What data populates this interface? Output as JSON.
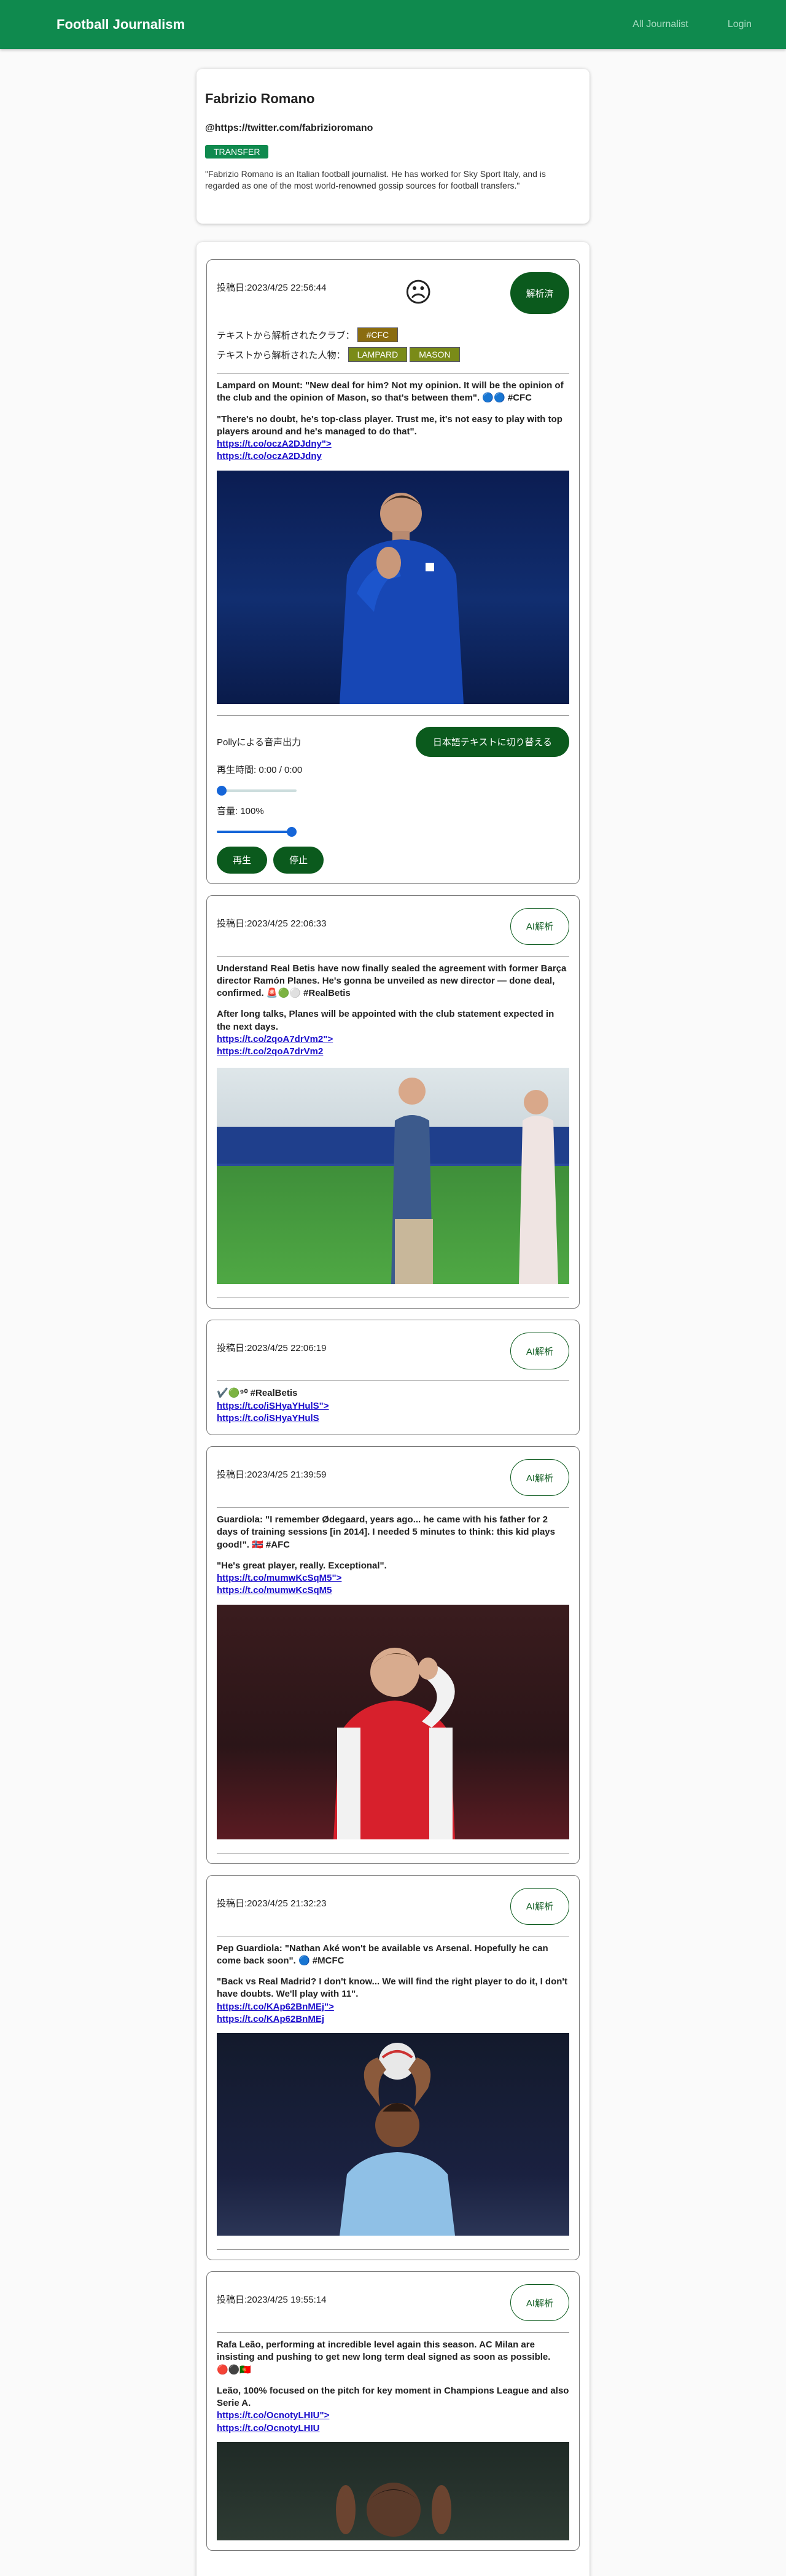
{
  "header": {
    "brand": "Football Journalism",
    "nav": [
      "All Journalist",
      "Login"
    ]
  },
  "profile": {
    "name": "Fabrizio Romano",
    "twitter": "@https://twitter.com/fabrizioromano",
    "tag": "TRANSFER",
    "bio": "\"Fabrizio Romano is an Italian football journalist. He has worked for Sky Sport Italy, and is regarded as one of the most world-renowned gossip sources for football transfers.\""
  },
  "labels": {
    "club": "テキストから解析されたクラブ：",
    "person": "テキストから解析された人物：",
    "done": "解析済",
    "ai": "AI解析",
    "polly": "Pollyによる音声出力",
    "switch_jp": "日本語テキストに切り替える",
    "time": "再生時間: 0:00 / 0:00",
    "volume": "音量: 100%",
    "play": "再生",
    "stop": "停止"
  },
  "audio": {
    "progress": 0,
    "volume": 1.0
  },
  "posts": [
    {
      "date": "投稿日:2023/4/25 22:56:44",
      "sentiment_icon": "sad-face-icon",
      "sentiment": "☹",
      "clubs": [
        "#CFC"
      ],
      "people": [
        "LAMPARD",
        "MASON"
      ],
      "p1": "Lampard on Mount: \"New deal for him? Not my opinion. It will be the opinion of the club and the opinion of Mason, so that's between them\". 🔵🔵 #CFC",
      "p2": "\"There's no doubt, he's top-class player. Trust me, it's not easy to play with top players around and he's managed to do that\".",
      "link1": "https://t.co/oczA2DJdny\">",
      "link2": "https://t.co/oczA2DJdny"
    },
    {
      "date": "投稿日:2023/4/25 22:06:33",
      "p1": "Understand Real Betis have now finally sealed the agreement with former Barça director Ramón Planes. He's gonna be unveiled as new director — done deal, confirmed. 🚨🟢⚪️ #RealBetis",
      "p2": "After long talks, Planes will be appointed with the club statement expected in the next days.",
      "link1": "https://t.co/2qoA7drVm2\">",
      "link2": "https://t.co/2qoA7drVm2"
    },
    {
      "date": "投稿日:2023/4/25 22:06:19",
      "p1": "✔️🟢⁹⁰ #RealBetis",
      "link1": "https://t.co/iSHyaYHulS\">",
      "link2": "https://t.co/iSHyaYHulS"
    },
    {
      "date": "投稿日:2023/4/25 21:39:59",
      "p1": "Guardiola: \"I remember Ødegaard, years ago... he came with his father for 2 days of training sessions [in 2014]. I needed 5 minutes to think: this kid plays good!\". 🇳🇴 #AFC",
      "p2": "\"He's great player, really. Exceptional\".",
      "link1": "https://t.co/mumwKcSqM5\">",
      "link2": "https://t.co/mumwKcSqM5"
    },
    {
      "date": "投稿日:2023/4/25 21:32:23",
      "p1": "Pep Guardiola: \"Nathan Aké won't be available vs Arsenal. Hopefully he can come back soon\". 🔵 #MCFC",
      "p2": "\"Back vs Real Madrid? I don't know... We will find the right player to do it, I don't have doubts. We'll play with 11\".",
      "link1": "https://t.co/KAp62BnMEj\">",
      "link2": "https://t.co/KAp62BnMEj"
    },
    {
      "date": "投稿日:2023/4/25 19:55:14",
      "p1": "Rafa Leão, performing at incredible level again this season. AC Milan are insisting and pushing to get new long term deal signed as soon as possible. 🔴⚫🇵🇹",
      "p2": "Leão, 100% focused on the pitch for key moment in Champions League and also Serie A.",
      "link1": "https://t.co/OcnotyLHIU\">",
      "link2": "https://t.co/OcnotyLHIU"
    }
  ]
}
